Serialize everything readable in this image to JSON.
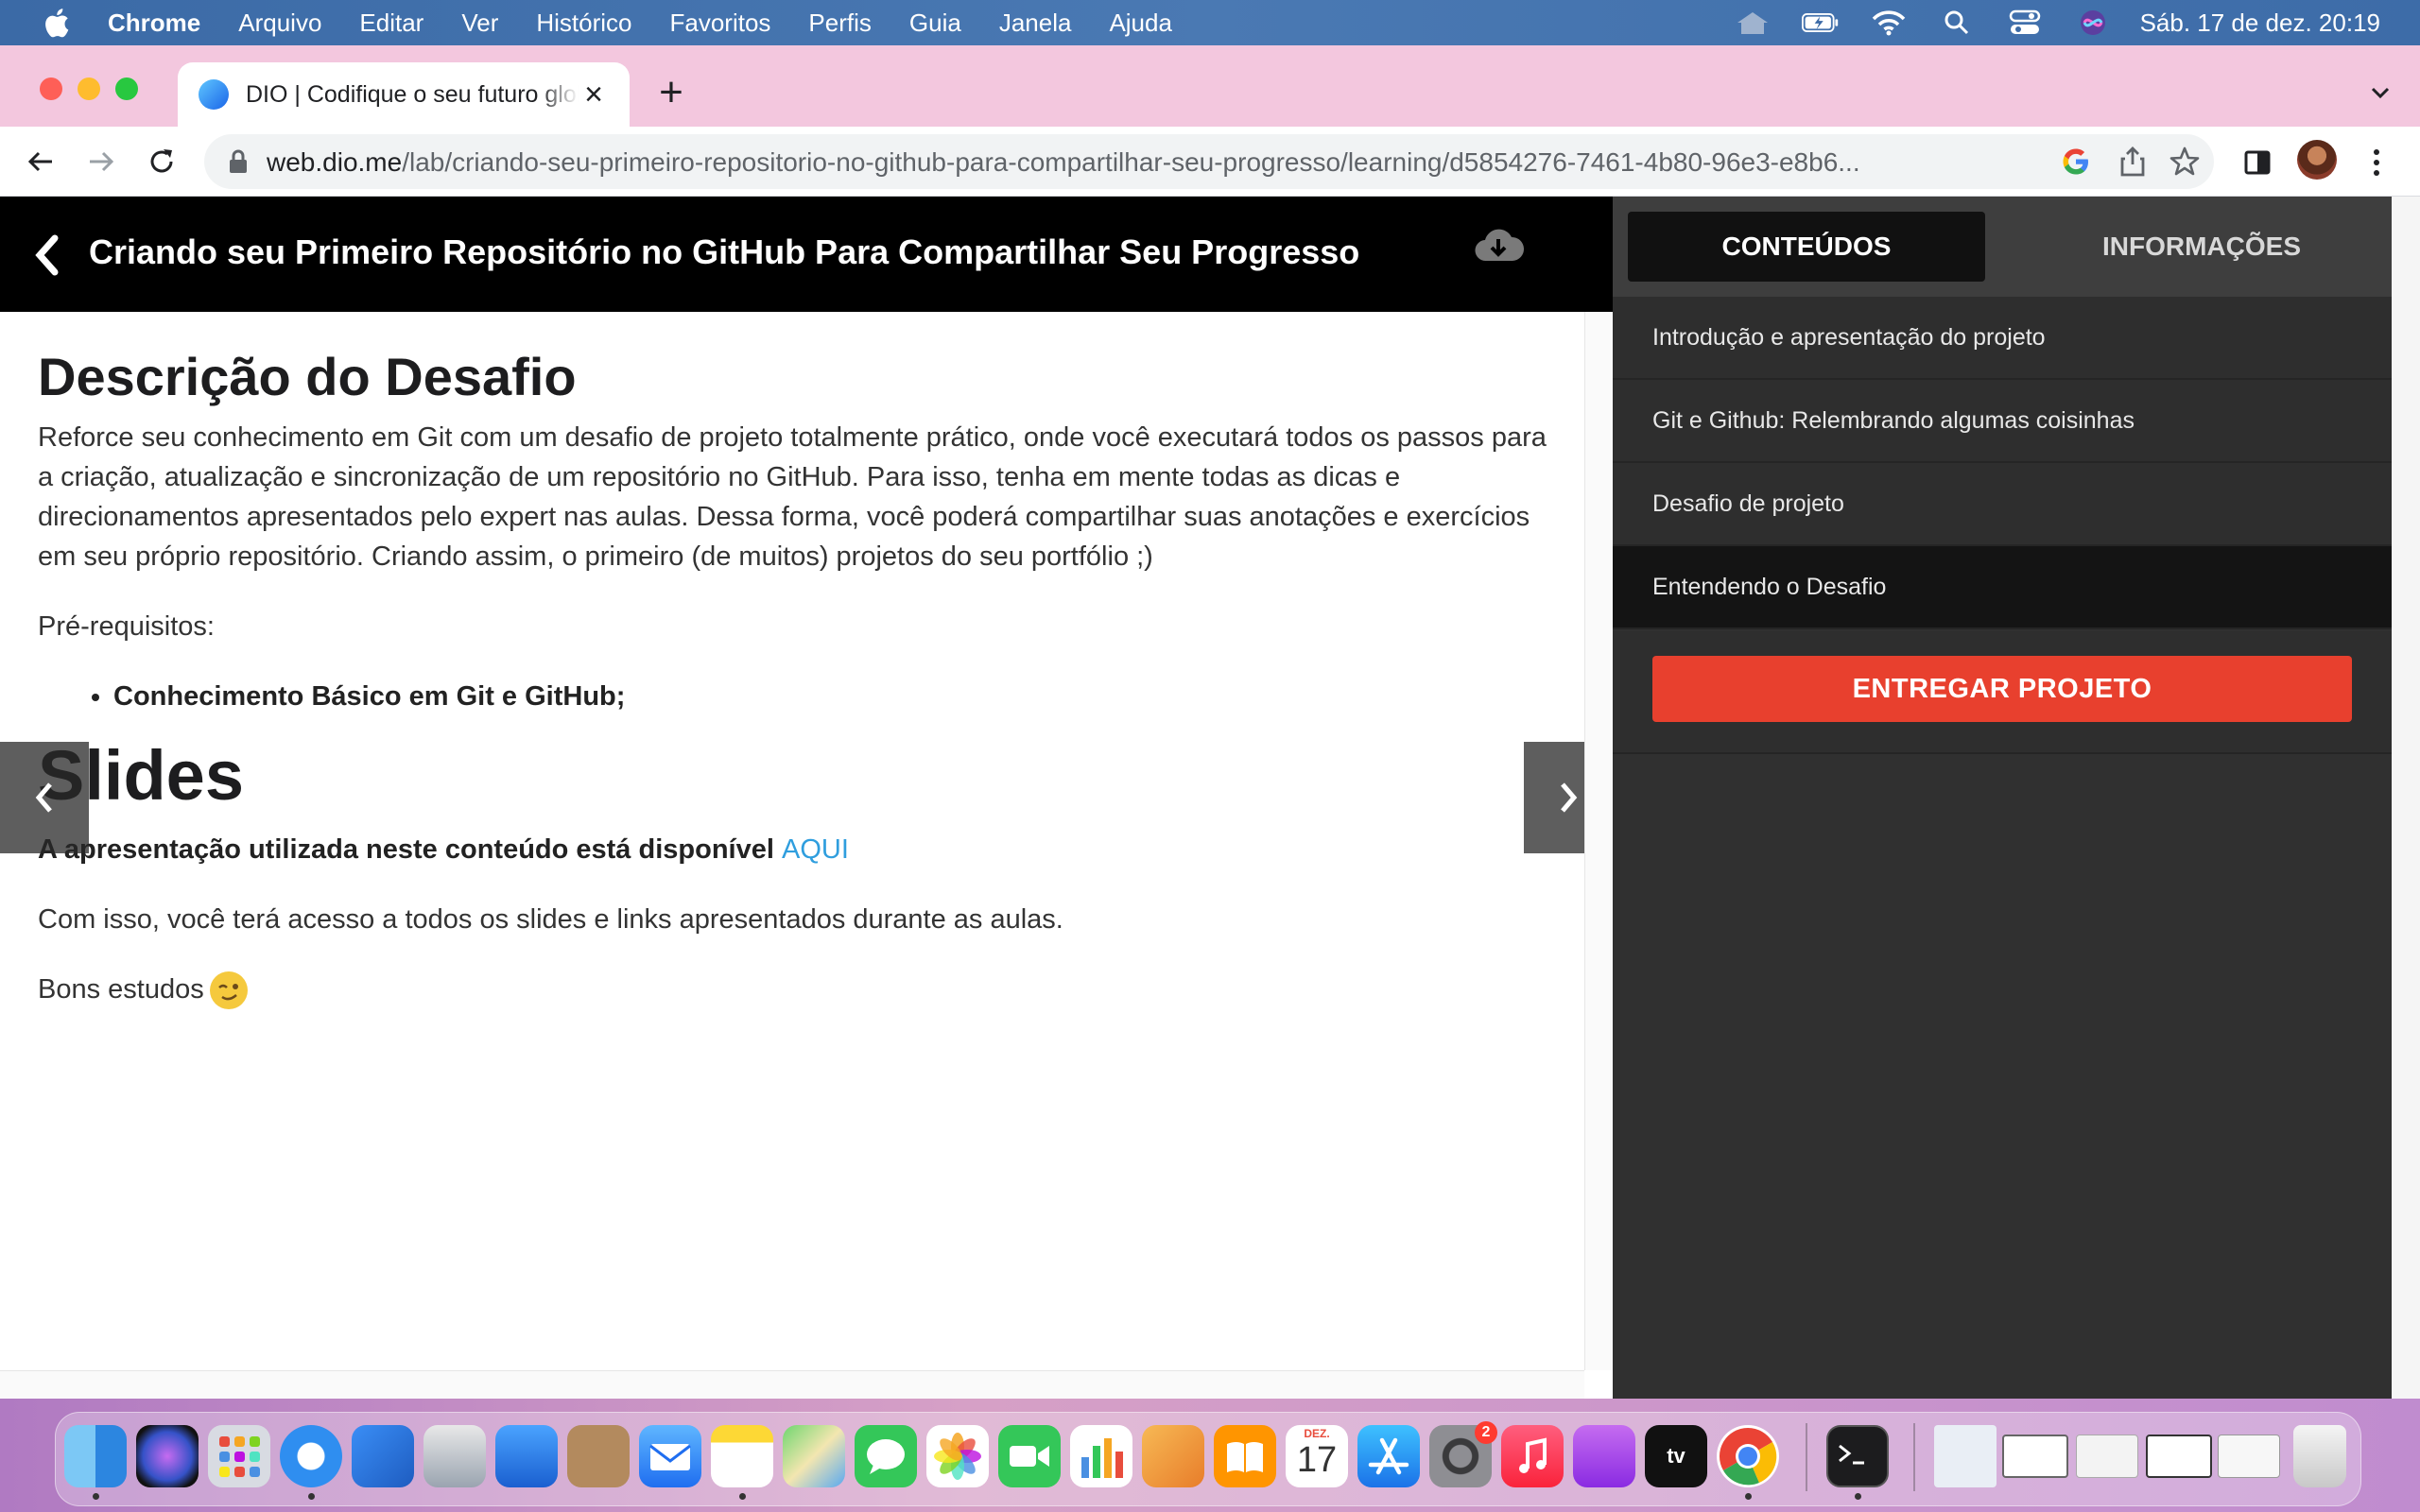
{
  "menubar": {
    "items": [
      "Chrome",
      "Arquivo",
      "Editar",
      "Ver",
      "Histórico",
      "Favoritos",
      "Perfis",
      "Guia",
      "Janela",
      "Ajuda"
    ],
    "clock": "Sáb. 17 de dez.  20:19"
  },
  "browser": {
    "tab_title": "DIO | Codifique o seu futuro global",
    "url_host": "web.dio.me",
    "url_path": "/lab/criando-seu-primeiro-repositorio-no-github-para-compartilhar-seu-progresso/learning/d5854276-7461-4b80-96e3-e8b6..."
  },
  "course": {
    "title": "Criando seu Primeiro Repositório no GitHub Para Compartilhar Seu Progresso"
  },
  "content": {
    "heading": "Descrição do Desafio",
    "description": "Reforce seu conhecimento em Git com um desafio de projeto totalmente prático, onde você executará todos os passos para a criação, atualização e sincronização de um repositório no GitHub. Para isso, tenha em mente todas as dicas e direcionamentos apresentados pelo expert nas aulas. Dessa forma, você poderá compartilhar suas anotações e exercícios em seu próprio repositório. Criando assim, o primeiro (de muitos) projetos do seu portfólio ;)",
    "prereq_label": "Pré-requisitos:",
    "prereq_items": [
      "Conhecimento Básico em Git e GitHub;"
    ],
    "slides_heading": "Slides",
    "slides_text": "A apresentação utilizada neste conteúdo está disponível",
    "slides_link": "AQUI",
    "access_text": "Com isso, você terá acesso a todos os slides e links apresentados durante as aulas.",
    "closing": "Bons estudos"
  },
  "sidebar": {
    "tabs": [
      "CONTEÚDOS",
      "INFORMAÇÕES"
    ],
    "lessons": [
      "Introdução e apresentação do projeto",
      "Git e Github: Relembrando algumas coisinhas",
      "Desafio de projeto",
      "Entendendo o Desafio"
    ],
    "submit_label": "ENTREGAR PROJETO"
  },
  "dock": {
    "calendar_month": "DEZ.",
    "calendar_day": "17",
    "settings_badge": "2"
  },
  "colors": {
    "accent_red": "#e8402e",
    "link_blue": "#2f9ede",
    "header_black": "#000000",
    "sidebar_dark": "#303030"
  }
}
